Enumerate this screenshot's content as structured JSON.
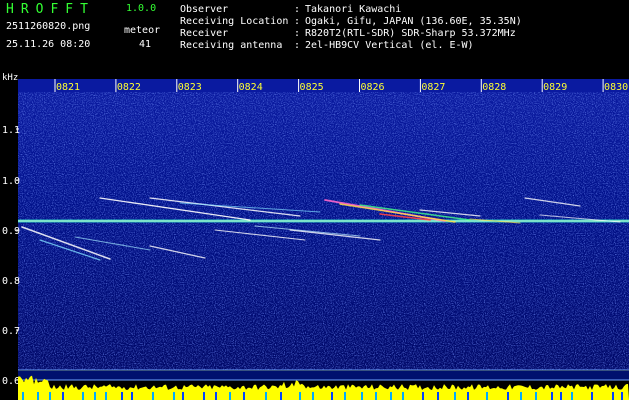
{
  "header": {
    "app_name": "HROFFT",
    "version": "1.0.0",
    "filename": "2511260820.png",
    "timestamp": "25.11.26 08:20",
    "meteor_label": "meteor",
    "meteor_count": "41"
  },
  "station": {
    "rows": [
      {
        "label": "Observer",
        "value": "Takanori Kawachi"
      },
      {
        "label": "Receiving Location",
        "value": "Ogaki, Gifu, JAPAN (136.60E, 35.35N)"
      },
      {
        "label": "Receiver",
        "value": "R820T2(RTL-SDR) SDR-Sharp 53.372MHz"
      },
      {
        "label": "Receiving antenna",
        "value": "2el-HB9CV Vertical (el. E-W)"
      }
    ],
    "separator": ":"
  },
  "axes": {
    "unit": "kHz",
    "time_ticks": [
      "0821",
      "0822",
      "0823",
      "0824",
      "0825",
      "0826",
      "0827",
      "0828",
      "0829",
      "0830"
    ],
    "freq_ticks": [
      "1.1",
      "1.0",
      "0.9",
      "0.8",
      "0.7",
      "0.6"
    ]
  },
  "colors": {
    "background": "#000000",
    "header_text": "#ffffff",
    "accent_green": "#33ff33",
    "tick_text": "#ffff33",
    "spectrogram_base": "#00007a",
    "carrier_line": "#2ec4c4",
    "meteor_trail": "#ffffff",
    "power_band": "#ffff00"
  }
}
